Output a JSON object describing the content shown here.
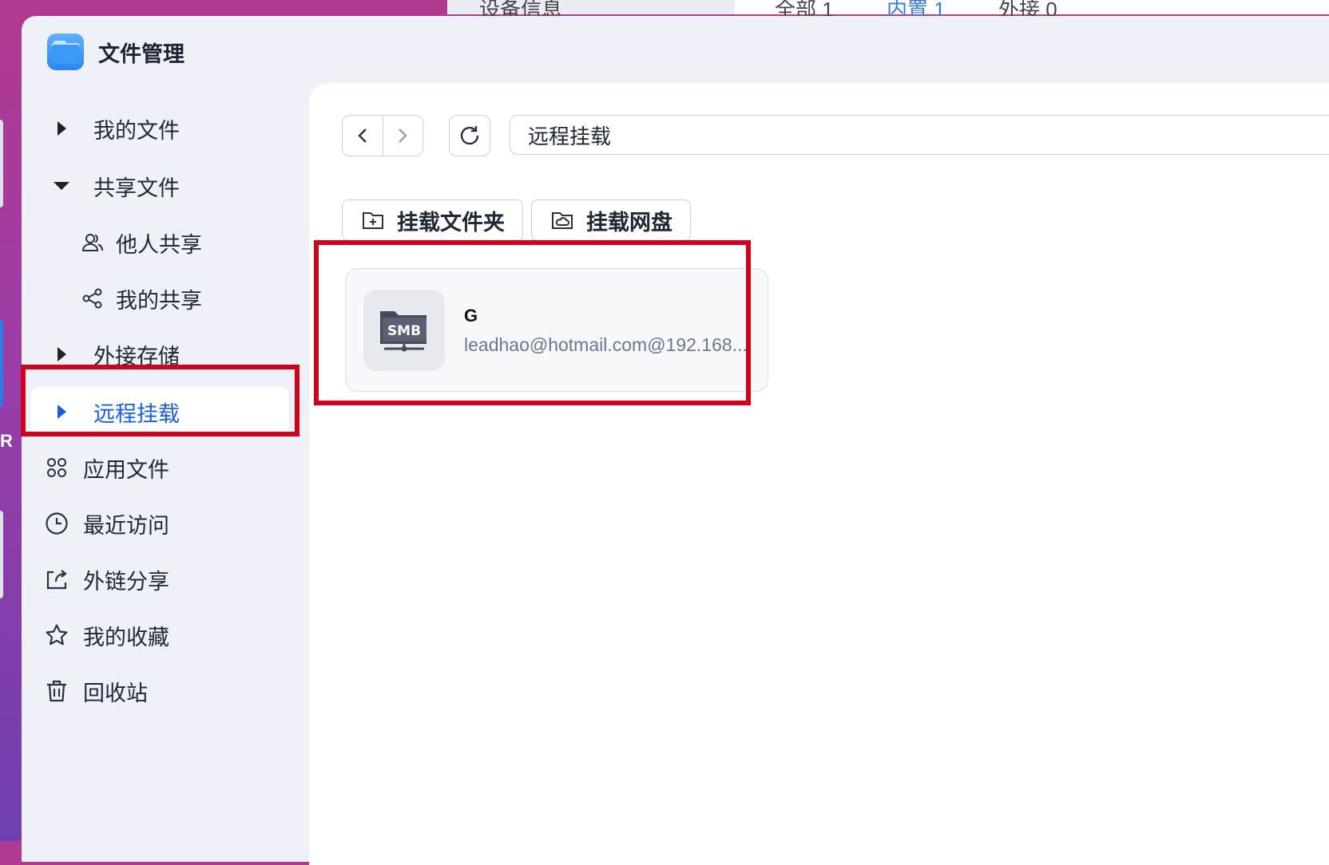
{
  "background": {
    "tab_text_1": "设备信息",
    "tab_text_2": "全部 1",
    "tab_text_3": "内置 1",
    "tab_text_4": "外接 0",
    "edge_letter": "R"
  },
  "app": {
    "title": "文件管理",
    "logo_icon": "folder-app-icon"
  },
  "sidebar": {
    "items": [
      {
        "label": "我的文件",
        "icon": "caret-right-icon"
      },
      {
        "label": "共享文件",
        "icon": "caret-down-icon"
      },
      {
        "label": "他人共享",
        "icon": "users-icon"
      },
      {
        "label": "我的共享",
        "icon": "share-icon"
      },
      {
        "label": "外接存储",
        "icon": "caret-right-icon"
      },
      {
        "label": "远程挂载",
        "icon": "caret-right-icon",
        "active": true
      },
      {
        "label": "应用文件",
        "icon": "apps-icon"
      },
      {
        "label": "最近访问",
        "icon": "clock-icon"
      },
      {
        "label": "外链分享",
        "icon": "external-share-icon"
      },
      {
        "label": "我的收藏",
        "icon": "star-icon"
      },
      {
        "label": "回收站",
        "icon": "trash-icon"
      }
    ]
  },
  "toolbar": {
    "path": "远程挂载"
  },
  "actions": {
    "mount_folder": "挂载文件夹",
    "mount_netdisk": "挂载网盘"
  },
  "mounts": [
    {
      "badge": "SMB",
      "name": "G",
      "address": "leadhao@hotmail.com@192.168...."
    }
  ],
  "colors": {
    "accent": "#1a5ce0",
    "highlight": "#d0021b",
    "sidebar_bg": "#eef1f7"
  }
}
